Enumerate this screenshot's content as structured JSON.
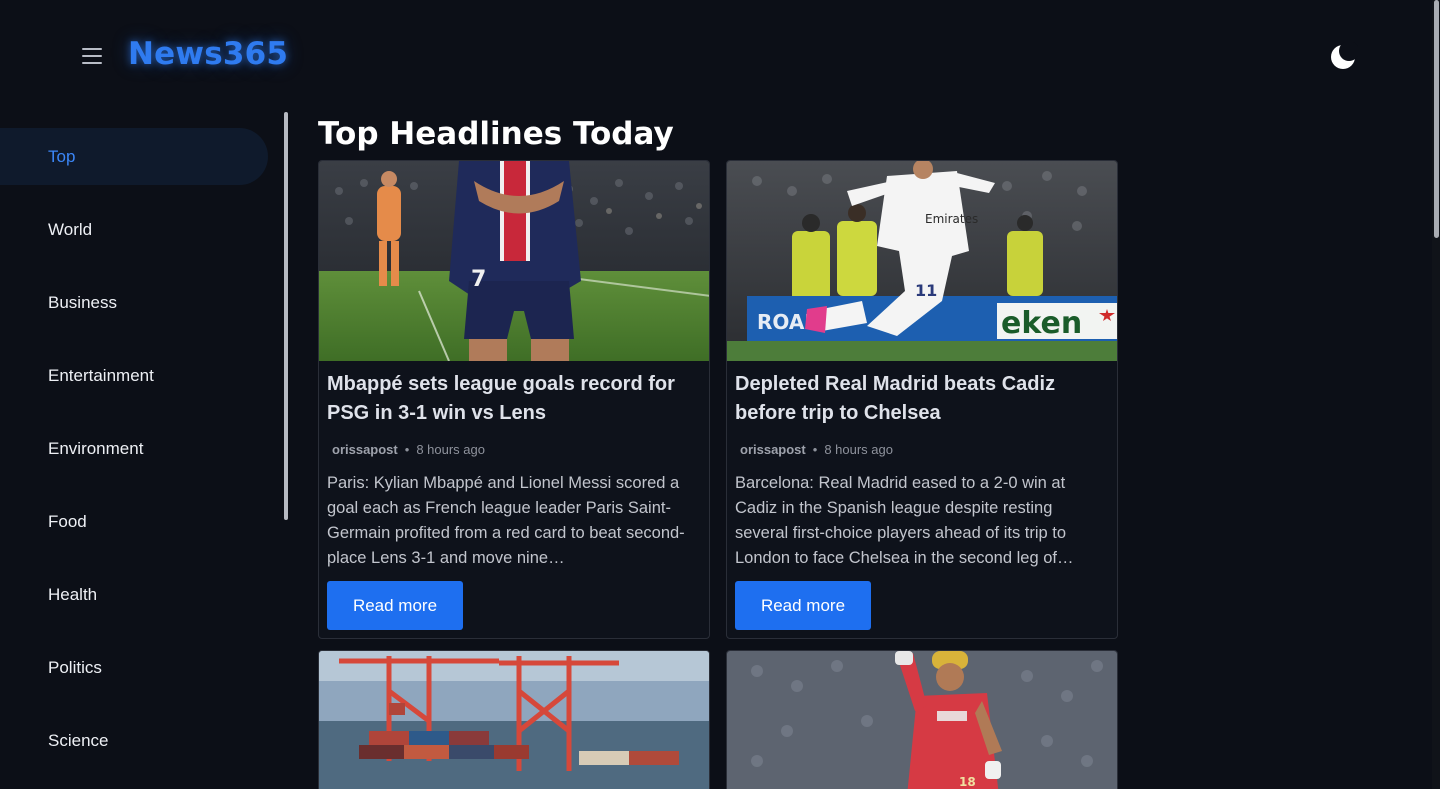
{
  "header": {
    "logo": "News365",
    "menu_icon": "hamburger-menu-icon",
    "theme_icon": "moon-icon"
  },
  "sidebar": {
    "items": [
      {
        "label": "Top",
        "active": true
      },
      {
        "label": "World",
        "active": false
      },
      {
        "label": "Business",
        "active": false
      },
      {
        "label": "Entertainment",
        "active": false
      },
      {
        "label": "Environment",
        "active": false
      },
      {
        "label": "Food",
        "active": false
      },
      {
        "label": "Health",
        "active": false
      },
      {
        "label": "Politics",
        "active": false
      },
      {
        "label": "Science",
        "active": false
      }
    ]
  },
  "main": {
    "title": "Top Headlines Today",
    "articles": [
      {
        "title": "Mbappé sets league goals record for PSG in 3-1 win vs Lens",
        "source": "orissapost",
        "time": "8 hours ago",
        "description": "Paris: Kylian Mbappé and Lionel Messi scored a goal each as French league leader Paris Saint-Germain profited from a red card to beat second-place Lens 3-1 and move nine…",
        "button": "Read more",
        "image": "soccer-player-psg-photo"
      },
      {
        "title": "Depleted Real Madrid beats Cadiz before trip to Chelsea",
        "source": "orissapost",
        "time": "8 hours ago",
        "description": "Barcelona: Real Madrid eased to a 2-0 win at Cadiz in the Spanish league despite resting several first-choice players ahead of its trip to London to face Chelsea in the second leg of…",
        "button": "Read more",
        "image": "soccer-player-real-madrid-photo"
      },
      {
        "image": "container-port-cranes-photo"
      },
      {
        "image": "cricket-player-photo"
      }
    ]
  },
  "colors": {
    "background": "#0c0f17",
    "accent": "#1e6ff0",
    "logo": "#2f7bf0",
    "active_nav_bg": "#0f1a2c"
  }
}
